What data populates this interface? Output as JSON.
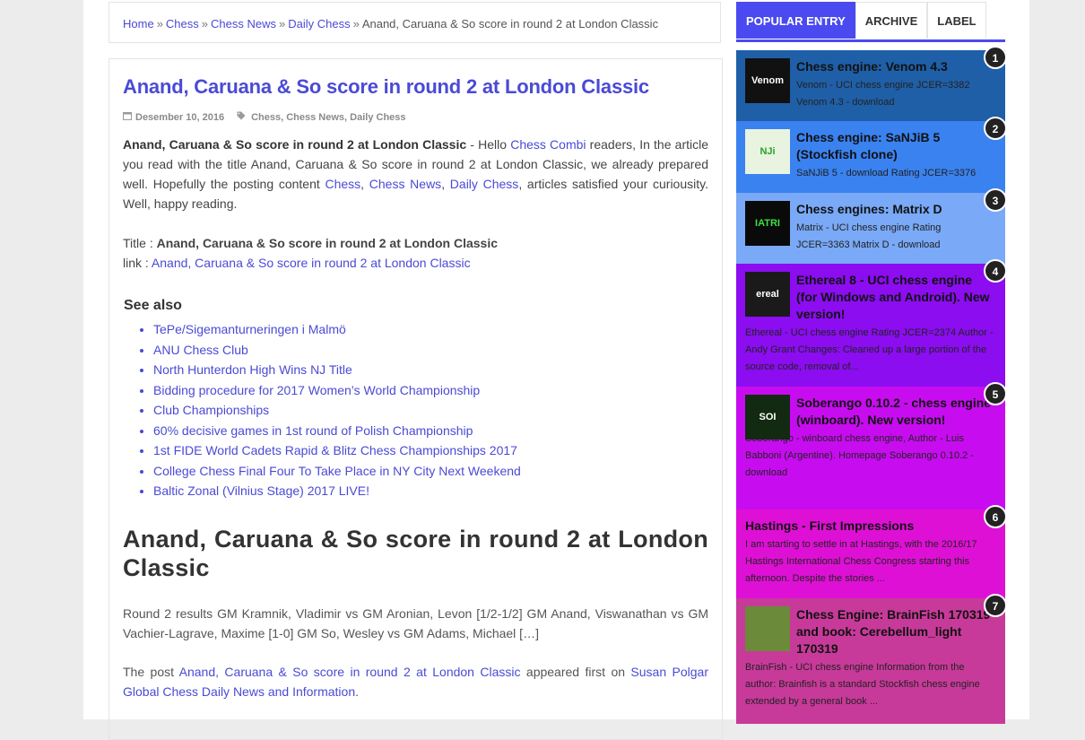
{
  "breadcrumb": {
    "home": "Home",
    "chess": "Chess",
    "chess_news": "Chess News",
    "daily_chess": "Daily Chess",
    "separator": "»",
    "current": "Anand, Caruana & So score in round 2 at London Classic"
  },
  "article": {
    "title": "Anand, Caruana & So score in round 2 at London Classic",
    "date": "Desember 10, 2016",
    "categories": [
      "Chess",
      "Chess News",
      "Daily Chess"
    ],
    "intro": {
      "bold_title": "Anand, Caruana & So score in round 2 at London Classic",
      "part1": " - Hello ",
      "site_link": "Chess Combi",
      "part2": " readers, In the article you read with the title Anand, Caruana & So score in round 2 at London Classic, we already prepared well. Hopefully the posting content ",
      "link_chess": "Chess",
      "comma1": ", ",
      "link_news": "Chess News",
      "comma2": ", ",
      "link_daily": "Daily Chess",
      "part3": ", articles satisfied your curiousity. Well, happy reading."
    },
    "title_label": "Title : ",
    "title_value": "Anand, Caruana & So score in round 2 at London Classic",
    "link_label": "link : ",
    "link_value": "Anand, Caruana & So score in round 2 at London Classic",
    "see_also_heading": "See also",
    "see_also": [
      "TePe/Sigemanturneringen i Malmö",
      "ANU Chess Club",
      "North Hunterdon High Wins NJ Title",
      "Bidding procedure for 2017 Women’s World Championship",
      "Club Championships",
      "60% decisive games in 1st round of Polish Championship",
      "1st FIDE World Cadets Rapid & Blitz Chess Championships 2017",
      "College Chess Final Four To Take Place in NY City Next Weekend",
      "Baltic Zonal (Vilnius Stage) 2017 LIVE!"
    ],
    "big_heading": "Anand, Caruana & So score in round 2 at London Classic",
    "round_text": "Round 2 results GM Kramnik, Vladimir vs GM Aronian, Levon [1/2-1/2] GM Anand, Viswanathan vs GM Vachier-Lagrave, Maxime [1-0] GM So, Wesley vs GM Adams, Michael […]",
    "post_prefix": "The post ",
    "post_link": "Anand, Caruana & So score in round 2 at London Classic",
    "post_middle": " appeared first on ",
    "source_link": "Susan Polgar Global Chess Daily News and Information",
    "post_suffix": "."
  },
  "sidebar": {
    "tabs": [
      "POPULAR ENTRY",
      "ARCHIVE",
      "LABEL"
    ],
    "popular": [
      {
        "num": "1",
        "title": "Chess engine: Venom 4.3",
        "desc": "Venom   - UCI chess engine JCER=3382 Venom 4.3 - download",
        "bg": "#1f5fa8",
        "thumb_text": "Venom",
        "thumb_bg": "#111",
        "thumb_color": "#fff",
        "desc_indent": true
      },
      {
        "num": "2",
        "title": "Chess engine: SaNJiB 5 (Stockfish clone)",
        "desc": "SaNJiB 5 - download Rating JCER=3376",
        "bg": "#3a82f0",
        "thumb_text": "NJi",
        "thumb_bg": "#e8f4e0",
        "thumb_color": "#2aa02a",
        "desc_indent": true
      },
      {
        "num": "3",
        "title": "Chess engines: Matrix D",
        "desc": "Matrix   - UCI chess engine Rating JCER=3363 Matrix D - download",
        "bg": "#79a9f7",
        "thumb_text": "IATRI",
        "thumb_bg": "#0a0a0a",
        "thumb_color": "#3fe03f",
        "desc_indent": true
      },
      {
        "num": "4",
        "title": "Ethereal 8 - UCI chess engine (for Windows and Android). New version!",
        "desc": "Ethereal   - UCI chess engine Rating JCER=2374 Author - Andy Grant Changes: Cleaned up a large portion of the source code, removal of...",
        "bg": "#8b0df0",
        "thumb_text": "ereal",
        "thumb_bg": "#1a1a1a",
        "thumb_color": "#fff",
        "desc_indent": false
      },
      {
        "num": "5",
        "title": "Soberango 0.10.2 - chess engine (winboard). New version!",
        "desc": "Soberango   - winboard chess engine, Author - Luis Babboni (Argentine). Homepage  Soberango 0.10.2 - download",
        "bg": "#c80cf0",
        "thumb_text": "SOI",
        "thumb_bg": "#112a11",
        "thumb_color": "#fff",
        "desc_indent": false
      },
      {
        "num": "6",
        "title": "Hastings - First Impressions",
        "desc": "I am starting to settle in at Hastings, with the 2016/17 Hastings International Chess Congress starting this afternoon. Despite the stories ...",
        "bg": "#df10d6",
        "thumb_text": "",
        "thumb_bg": "",
        "thumb_color": "",
        "desc_indent": false
      },
      {
        "num": "7",
        "title": "Chess Engine: BrainFish 170319 and book: Cerebellum_light 170319",
        "desc": "BrainFish   - UCI chess engine Information from the author: Brainfish  is a standard  Stockfish  chess engine extended by a general book ...",
        "bg": "#c83a9a",
        "thumb_text": "",
        "thumb_bg": "#6b8a3a",
        "thumb_color": "#fff",
        "desc_indent": false
      }
    ]
  }
}
